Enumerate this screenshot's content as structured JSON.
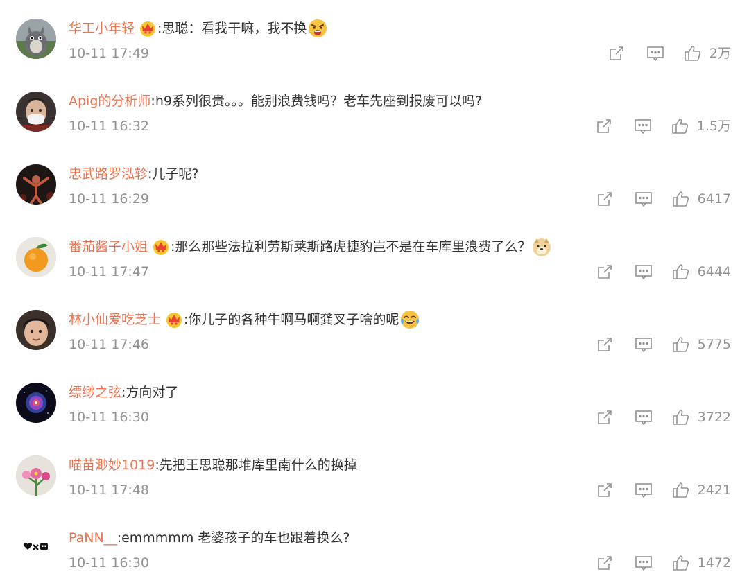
{
  "comments": [
    {
      "username": "华工小年轻",
      "vip": true,
      "text": "思聪：看我干嘛，我不换",
      "emoji": "angry-face-emoji",
      "time": "10-11 17:49",
      "likes": "2万",
      "avatar": "totoro-avatar"
    },
    {
      "username": "Apig的分析师",
      "vip": false,
      "text": "h9系列很贵。。。能别浪费钱吗？老车先座到报废可以吗?",
      "emoji": "",
      "time": "10-11 16:32",
      "likes": "1.5万",
      "avatar": "masked-person-avatar"
    },
    {
      "username": "忠武路罗泓轸",
      "vip": false,
      "text": "儿子呢?",
      "emoji": "",
      "time": "10-11 16:29",
      "likes": "6417",
      "avatar": "performer-avatar"
    },
    {
      "username": "番茄酱子小姐",
      "vip": true,
      "text": "那么那些法拉利劳斯莱斯路虎捷豹岂不是在车库里浪费了么？",
      "emoji": "doge-emoji",
      "time": "10-11 17:47",
      "likes": "6444",
      "avatar": "orange-avatar"
    },
    {
      "username": "林小仙爱吃芝士",
      "vip": true,
      "text": "你儿子的各种牛啊马啊龚叉子啥的呢",
      "emoji": "laughing-tears-emoji",
      "time": "10-11 17:46",
      "likes": "5775",
      "avatar": "child-face-avatar"
    },
    {
      "username": "缥缈之弦",
      "vip": false,
      "text": "方向对了",
      "emoji": "",
      "time": "10-11 16:30",
      "likes": "3722",
      "avatar": "nebula-avatar"
    },
    {
      "username": "喵苗渺妙1019",
      "vip": false,
      "text": "先把王思聪那堆库里南什么的换掉",
      "emoji": "",
      "time": "10-11 17:48",
      "likes": "2421",
      "avatar": "flowers-avatar"
    },
    {
      "username": "PaNN__",
      "vip": false,
      "text": "emmmmm 老婆孩子的车也跟着换么?",
      "emoji": "",
      "time": "10-11 16:30",
      "likes": "1472",
      "avatar": "heart-x-avatar"
    }
  ],
  "colors": {
    "username": "#eb7350",
    "text": "#333333",
    "meta": "#939393"
  }
}
